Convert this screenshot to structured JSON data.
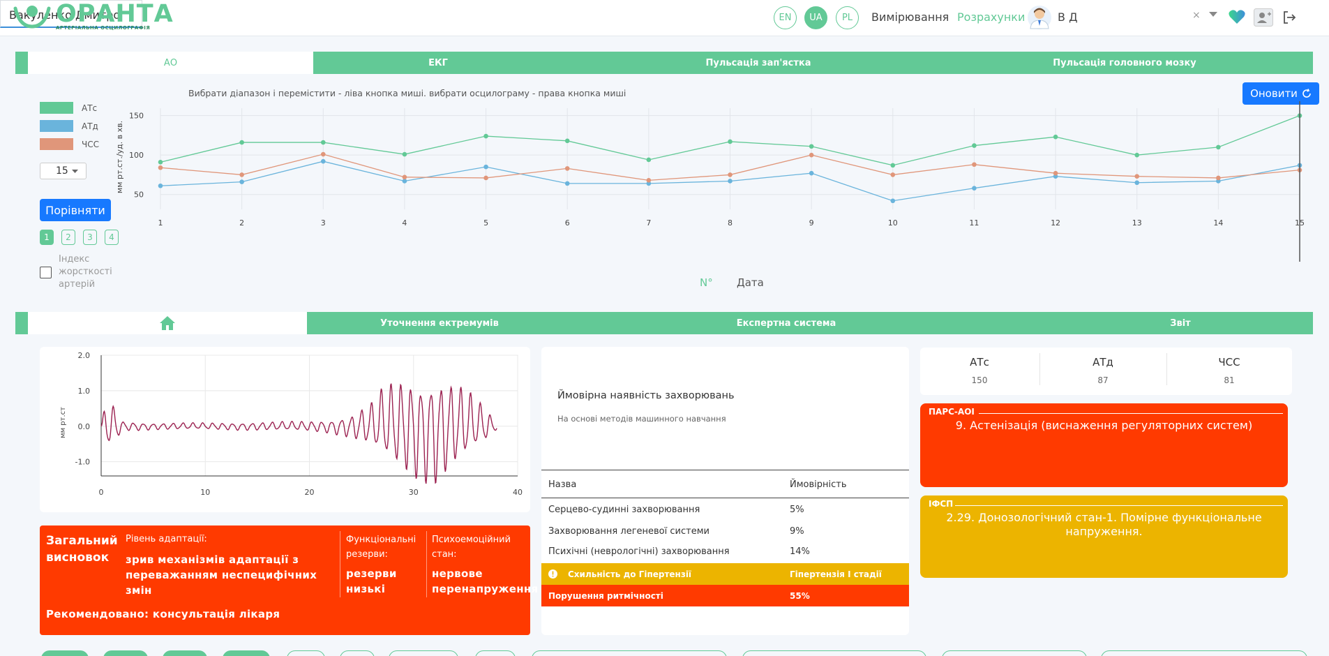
{
  "header": {
    "logo_title": "ОРАНТА",
    "logo_subtitle": "АРТЕРІАЛЬНА ОСЦИЛОГРАФІЯ",
    "languages": [
      "EN",
      "UA",
      "PL"
    ],
    "nav_measurements": "Вимірювання",
    "nav_calculations": "Розрахунки",
    "user_initials": "В Д",
    "patient_select": "Вакуленко Дмитро",
    "clear_glyph": "×"
  },
  "top_tabs": [
    "АО",
    "ЕКГ",
    "Пульсація зап'ястка",
    "Пульсація головного мозку"
  ],
  "left_panel": {
    "legend": [
      {
        "label": "АТс",
        "color": "#62c996"
      },
      {
        "label": "АТд",
        "color": "#6ab4dc"
      },
      {
        "label": "ЧСС",
        "color": "#e0967a"
      }
    ],
    "count_value": "15",
    "compare_button": "Порівняти",
    "pages": [
      "1",
      "2",
      "3",
      "4"
    ],
    "stiffness_label": "Індекс жорсткості артерій"
  },
  "trend_chart": {
    "hint": "Вибрати діапазон і перемістити - ліва кнопка миші. вибрати осцилограму - права кнопка миші",
    "refresh_button": "Оновити",
    "x_toggle_number": "N°",
    "x_toggle_date": "Дата"
  },
  "chart_data": [
    {
      "type": "line",
      "ylabel": "мм рт.ст./уд. в хв.",
      "xlabel": "",
      "x": [
        1,
        2,
        3,
        4,
        5,
        6,
        7,
        8,
        9,
        10,
        11,
        12,
        13,
        14,
        15
      ],
      "ylim": [
        40,
        155
      ],
      "yticks": [
        50,
        100,
        150
      ],
      "series": [
        {
          "name": "АТс",
          "color": "#62c996",
          "values": [
            91,
            116,
            116,
            101,
            124,
            118,
            94,
            117,
            111,
            87,
            112,
            123,
            100,
            110,
            150
          ]
        },
        {
          "name": "АТд",
          "color": "#6ab4dc",
          "values": [
            61,
            66,
            92,
            67,
            85,
            64,
            64,
            67,
            77,
            42,
            58,
            73,
            65,
            67,
            87
          ]
        },
        {
          "name": "ЧСС",
          "color": "#e0967a",
          "values": [
            84,
            75,
            101,
            72,
            71,
            83,
            68,
            75,
            100,
            75,
            88,
            77,
            73,
            71,
            81
          ]
        }
      ],
      "grid": true
    },
    {
      "type": "line",
      "ylabel": "мм рт.ст",
      "xlabel": "",
      "xticks": [
        0,
        10,
        20,
        30,
        40
      ],
      "yticks": [
        "2.0",
        "1.0",
        "0.0",
        "-1.0"
      ],
      "xlim": [
        0,
        40
      ],
      "ylim": [
        -1.4,
        2.0
      ],
      "series": [
        {
          "color": "#9b2150",
          "envelope": [
            [
              0,
              0.0
            ],
            [
              0.5,
              0.8
            ],
            [
              1.5,
              0.5
            ],
            [
              2,
              0.15
            ],
            [
              5,
              0.1
            ],
            [
              10,
              0.1
            ],
            [
              15,
              0.12
            ],
            [
              20,
              0.15
            ],
            [
              22,
              0.2
            ],
            [
              24,
              0.35
            ],
            [
              26,
              0.7
            ],
            [
              27,
              1.1
            ],
            [
              28,
              1.3
            ],
            [
              29,
              1.45
            ],
            [
              30,
              1.55
            ],
            [
              31,
              1.6
            ],
            [
              32,
              1.7
            ],
            [
              33,
              1.5
            ],
            [
              34,
              1.3
            ],
            [
              35,
              1.1
            ],
            [
              36,
              0.8
            ],
            [
              37,
              0.5
            ],
            [
              38,
              0.1
            ]
          ]
        }
      ],
      "grid": true
    }
  ],
  "bottom_tabs": [
    "Уточнення ектремумів",
    "Експертна система",
    "Звіт"
  ],
  "home_icon_name": "home-icon",
  "conclusion": {
    "title": "Загальний висновок",
    "adaptation_label": "Рівень адаптації:",
    "adaptation_value": "зрив механізмів адаптації з переважанням неспецифічних змін",
    "reserves_label": "Функціональні резерви:",
    "reserves_value": "резерви низькі",
    "psycho_label": "Психоемоційний стан:",
    "psycho_value": "нервове перенапруження",
    "recommendation": "Рекомендовано: консультація лікаря"
  },
  "diseases": {
    "title": "Ймовірна наявність захворювань",
    "subtitle": "На основі методів машинного навчання",
    "col_name": "Назва",
    "col_prob": "Ймовірність",
    "rows": [
      {
        "name": "Серцево-судинні захворювання",
        "prob": "5%"
      },
      {
        "name": "Захворювання легеневої системи",
        "prob": "9%"
      },
      {
        "name": "Психічні (неврологічні) захворювання",
        "prob": "14%"
      }
    ],
    "warn_row": {
      "name": "Схильність до Гіпертензії",
      "prob": "Гіпертензія І стадії",
      "color": "#ecb400"
    },
    "alert_row": {
      "name": "Порушення ритмічності",
      "prob": "55%",
      "color": "#ff3a00"
    }
  },
  "stats": [
    {
      "label": "АТс",
      "value": "150"
    },
    {
      "label": "АТд",
      "value": "87"
    },
    {
      "label": "ЧСС",
      "value": "81"
    }
  ],
  "pars": {
    "label": "ПАРС-АОІ",
    "text": "9. Астенізація (виснаження регуляторних систем)",
    "color": "#ff3a00"
  },
  "ifsp": {
    "label": "ІФСП",
    "text": "2.29. Донозологічний стан-1. Помірне функціональне напруження.",
    "color": "#ecb400"
  }
}
